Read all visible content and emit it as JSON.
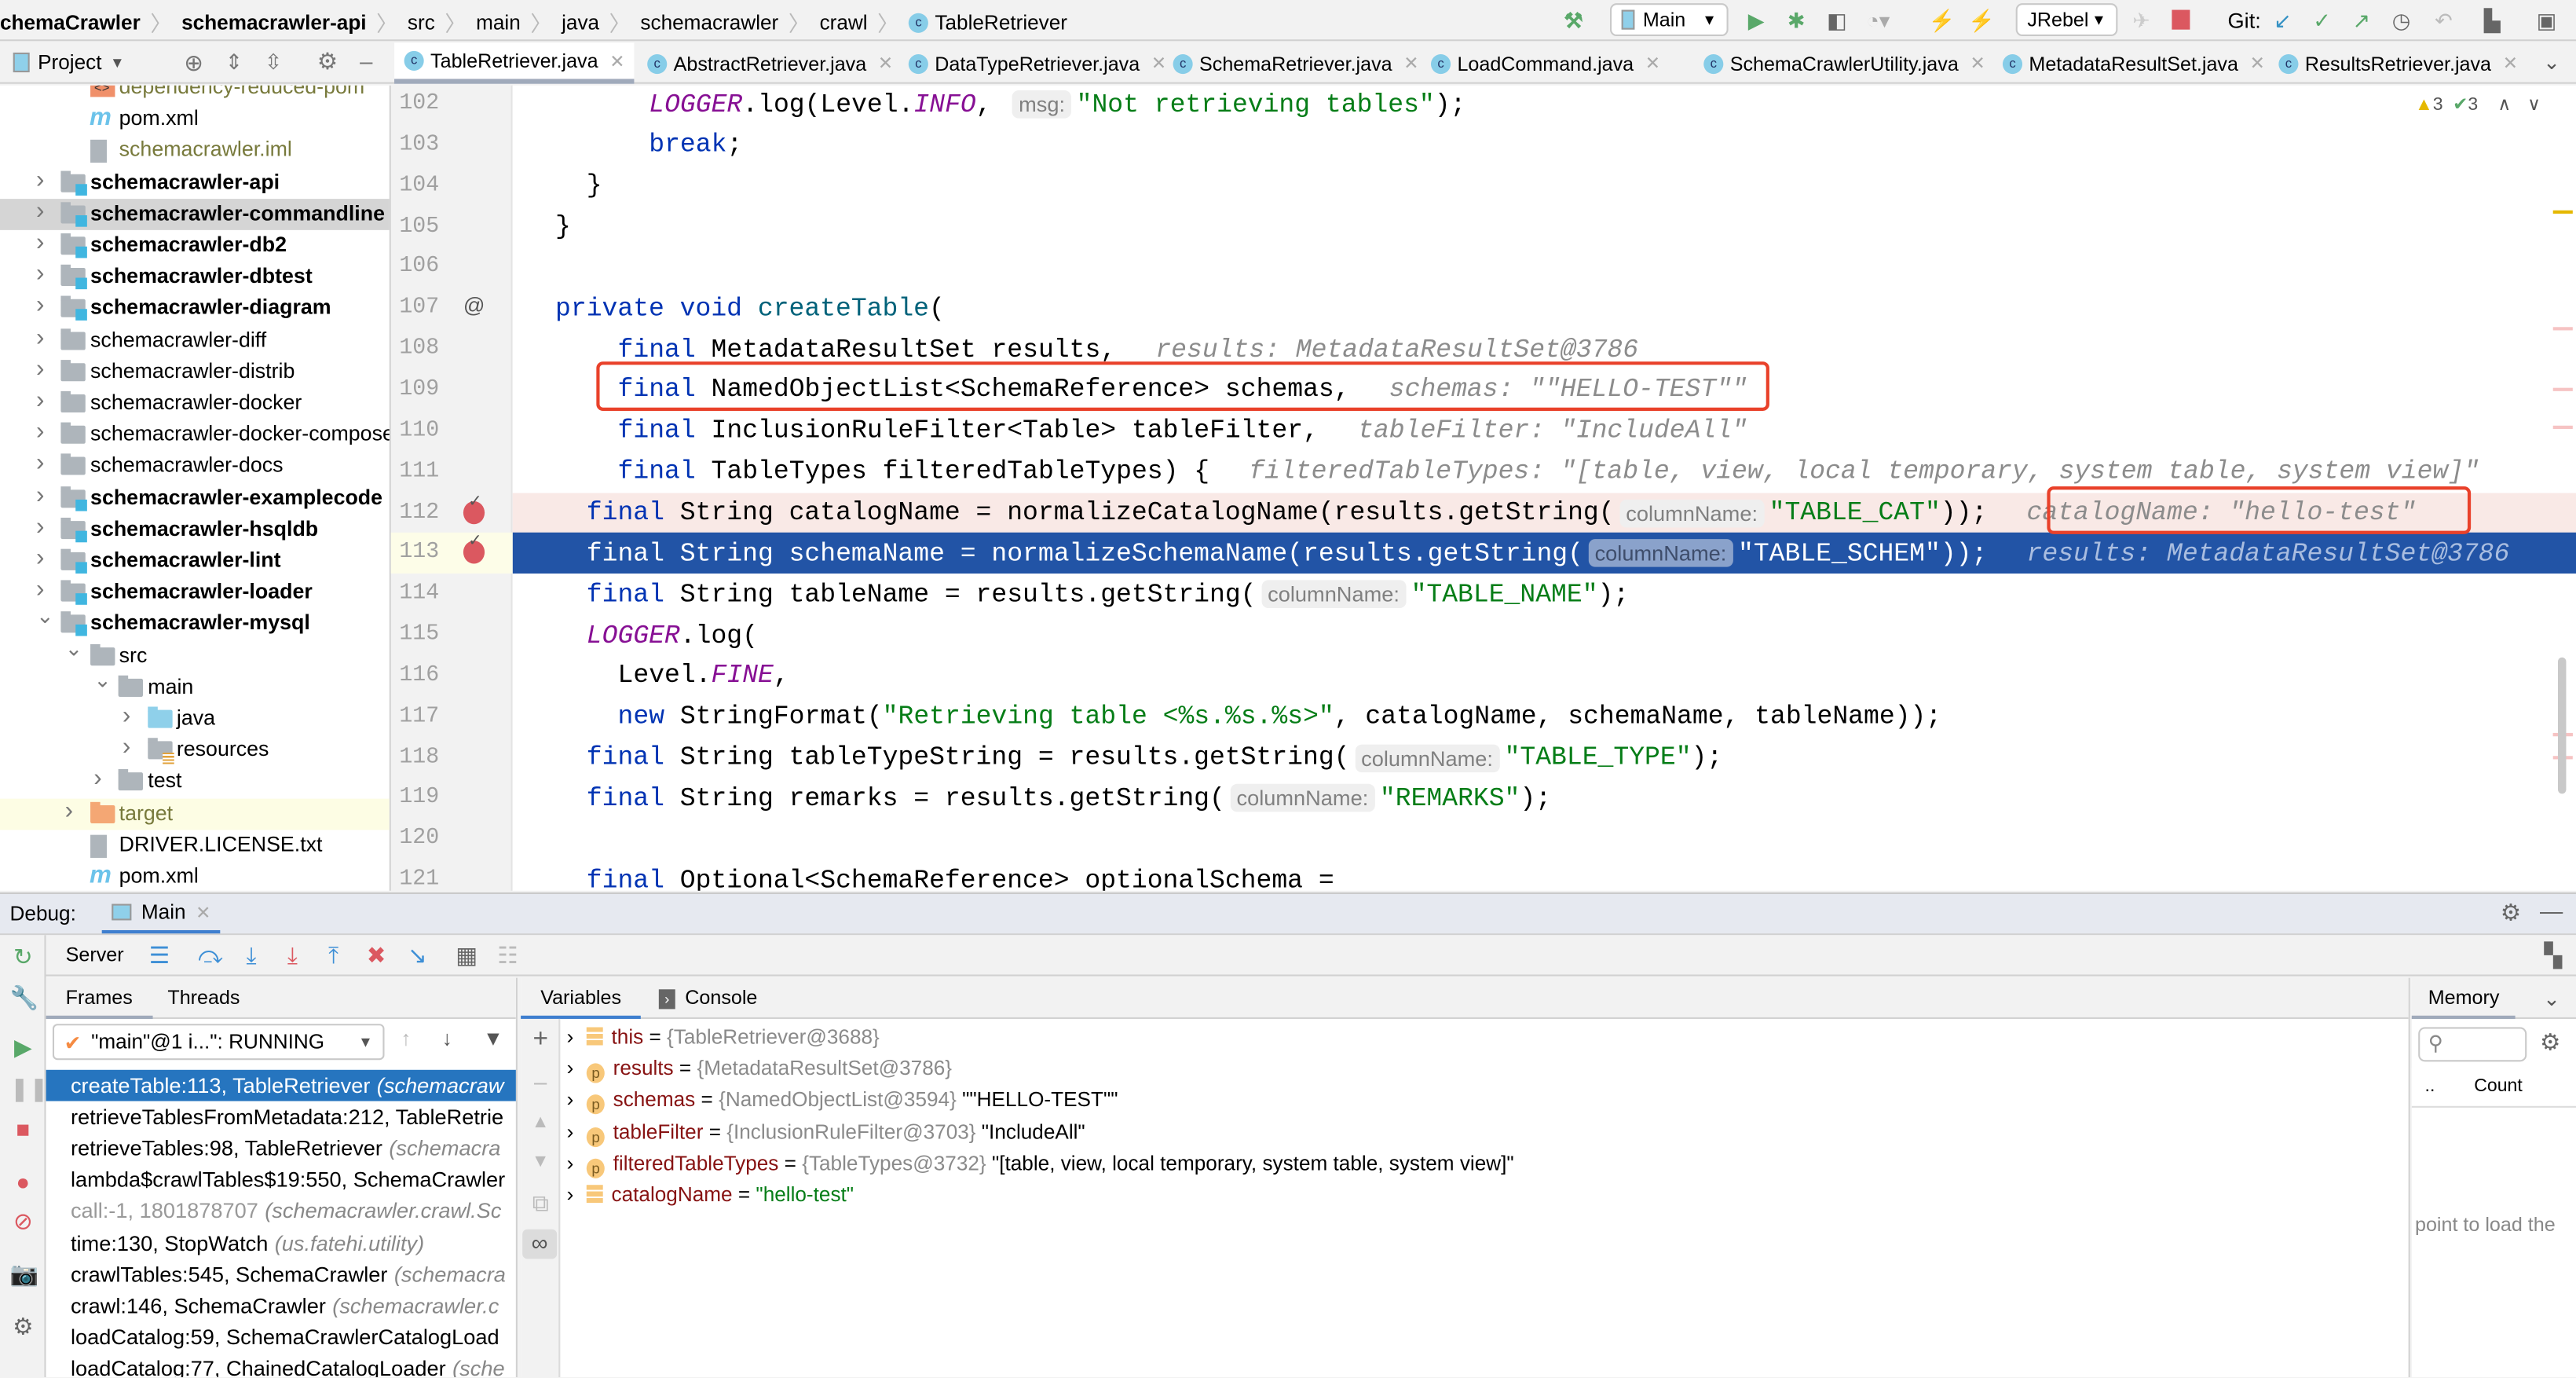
{
  "colors": {
    "accent": "#2675bf",
    "current_line": "#2254a6",
    "breakpoint_line": "#f9e9e6",
    "breakpoint": "#db5860",
    "highlight_box": "#e9412a"
  },
  "breadcrumb": [
    {
      "label": "chemaCrawler",
      "bold": true
    },
    {
      "label": "schemacrawler-api",
      "bold": true
    },
    {
      "label": "src"
    },
    {
      "label": "main"
    },
    {
      "label": "java"
    },
    {
      "label": "schemacrawler"
    },
    {
      "label": "crawl"
    },
    {
      "label": "TableRetriever",
      "icon": "class-icon"
    }
  ],
  "toolbar": {
    "run_config": "Main",
    "jrebel_config": "JRebel",
    "git_label": "Git:"
  },
  "project_panel": {
    "title": "Project"
  },
  "editor_tabs": [
    "TableRetriever.java",
    "AbstractRetriever.java",
    "DataTypeRetriever.java",
    "SchemaRetriever.java",
    "LoadCommand.java",
    "SchemaCrawlerUtility.java",
    "MetadataResultSet.java",
    "ResultsRetriever.java"
  ],
  "inspections": {
    "warnings": "3",
    "weak_warnings": "3"
  },
  "tree": [
    {
      "label": "dependency-reduced-pom",
      "depth": 1,
      "icon": "xml",
      "color": "olive"
    },
    {
      "label": "pom.xml",
      "depth": 1,
      "icon": "maven"
    },
    {
      "label": "schemacrawler.iml",
      "depth": 1,
      "icon": "iml",
      "color": "olive"
    },
    {
      "label": "schemacrawler-api",
      "depth": 0,
      "icon": "module",
      "bold": true,
      "chevron": "closed"
    },
    {
      "label": "schemacrawler-commandline",
      "depth": 0,
      "icon": "module",
      "bold": true,
      "chevron": "closed",
      "selected": true
    },
    {
      "label": "schemacrawler-db2",
      "depth": 0,
      "icon": "module",
      "bold": true,
      "chevron": "closed"
    },
    {
      "label": "schemacrawler-dbtest",
      "depth": 0,
      "icon": "module",
      "bold": true,
      "chevron": "closed"
    },
    {
      "label": "schemacrawler-diagram",
      "depth": 0,
      "icon": "module",
      "bold": true,
      "chevron": "closed"
    },
    {
      "label": "schemacrawler-diff",
      "depth": 0,
      "icon": "folder",
      "chevron": "closed"
    },
    {
      "label": "schemacrawler-distrib",
      "depth": 0,
      "icon": "folder",
      "chevron": "closed"
    },
    {
      "label": "schemacrawler-docker",
      "depth": 0,
      "icon": "folder",
      "chevron": "closed"
    },
    {
      "label": "schemacrawler-docker-compose",
      "depth": 0,
      "icon": "folder",
      "chevron": "closed"
    },
    {
      "label": "schemacrawler-docs",
      "depth": 0,
      "icon": "folder",
      "chevron": "closed"
    },
    {
      "label": "schemacrawler-examplecode",
      "depth": 0,
      "icon": "module",
      "bold": true,
      "chevron": "closed"
    },
    {
      "label": "schemacrawler-hsqldb",
      "depth": 0,
      "icon": "module",
      "bold": true,
      "chevron": "closed"
    },
    {
      "label": "schemacrawler-lint",
      "depth": 0,
      "icon": "module",
      "bold": true,
      "chevron": "closed"
    },
    {
      "label": "schemacrawler-loader",
      "depth": 0,
      "icon": "module",
      "bold": true,
      "chevron": "closed"
    },
    {
      "label": "schemacrawler-mysql",
      "depth": 0,
      "icon": "module",
      "bold": true,
      "chevron": "open"
    },
    {
      "label": "src",
      "depth": 1,
      "icon": "folder",
      "chevron": "open"
    },
    {
      "label": "main",
      "depth": 2,
      "icon": "folder",
      "chevron": "open"
    },
    {
      "label": "java",
      "depth": 3,
      "icon": "source",
      "chevron": "closed"
    },
    {
      "label": "resources",
      "depth": 3,
      "icon": "resources",
      "chevron": "closed"
    },
    {
      "label": "test",
      "depth": 2,
      "icon": "folder",
      "chevron": "closed"
    },
    {
      "label": "target",
      "depth": 1,
      "icon": "excluded",
      "chevron": "closed",
      "color": "olive",
      "highlight": true
    },
    {
      "label": "DRIVER.LICENSE.txt",
      "depth": 1,
      "icon": "text"
    },
    {
      "label": "pom.xml",
      "depth": 1,
      "icon": "maven"
    }
  ],
  "code": {
    "first_line": 102,
    "current_line": 113,
    "breakpoint_lines": [
      112,
      113
    ],
    "lines": [
      {
        "indent": 6,
        "tokens": [
          [
            "cst",
            "LOGGER"
          ],
          [
            "",
            ".log(Level."
          ],
          [
            "cst",
            "INFO"
          ],
          [
            "",
            ", "
          ],
          [
            "hint",
            "msg:"
          ],
          [
            "str",
            "\"Not retrieving tables\""
          ],
          [
            "",
            ");"
          ]
        ]
      },
      {
        "indent": 6,
        "tokens": [
          [
            "kw",
            "break"
          ],
          [
            "",
            ";"
          ]
        ]
      },
      {
        "indent": 2,
        "tokens": [
          [
            "",
            "}"
          ]
        ]
      },
      {
        "indent": 0,
        "tokens": [
          [
            "",
            "}"
          ]
        ]
      },
      {
        "indent": 0,
        "tokens": []
      },
      {
        "indent": 0,
        "tokens": [
          [
            "kw",
            "private void "
          ],
          [
            "fn",
            "createTable"
          ],
          [
            "",
            "("
          ]
        ]
      },
      {
        "indent": 4,
        "tokens": [
          [
            "kw",
            "final "
          ],
          [
            "",
            "MetadataResultSet results,"
          ],
          [
            "val",
            "results: MetadataResultSet@3786"
          ]
        ]
      },
      {
        "indent": 4,
        "tokens": [
          [
            "kw",
            "final "
          ],
          [
            "",
            "NamedObjectList<SchemaReference> schemas,"
          ],
          [
            "val",
            "schemas: \"\"HELLO-TEST\"\""
          ]
        ],
        "boxed": true
      },
      {
        "indent": 4,
        "tokens": [
          [
            "kw",
            "final "
          ],
          [
            "",
            "InclusionRuleFilter<Table> tableFilter,"
          ],
          [
            "val",
            "tableFilter: \"IncludeAll\""
          ]
        ]
      },
      {
        "indent": 4,
        "tokens": [
          [
            "kw",
            "final "
          ],
          [
            "",
            "TableTypes filteredTableTypes) {"
          ],
          [
            "val",
            "filteredTableTypes: \"[table, view, local temporary, system table, system view]\""
          ]
        ]
      },
      {
        "indent": 2,
        "tokens": [
          [
            "kw",
            "final "
          ],
          [
            "",
            "String catalogName = normalizeCatalogName(results.getString("
          ],
          [
            "hint",
            "columnName:"
          ],
          [
            "str",
            "\"TABLE_CAT\""
          ],
          [
            "",
            "));"
          ],
          [
            "val",
            "catalogName: \"hello-test\""
          ]
        ],
        "boxed_value": true
      },
      {
        "indent": 2,
        "tokens": [
          [
            "kw",
            "final "
          ],
          [
            "",
            "String schemaName = normalizeSchemaName(results.getString("
          ],
          [
            "hint",
            "columnName:"
          ],
          [
            "str",
            "\"TABLE_SCHEM\""
          ],
          [
            "",
            "));"
          ],
          [
            "val",
            "results: MetadataResultSet@3786"
          ]
        ]
      },
      {
        "indent": 2,
        "tokens": [
          [
            "kw",
            "final "
          ],
          [
            "",
            "String tableName = results.getString("
          ],
          [
            "hint",
            "columnName:"
          ],
          [
            "str",
            "\"TABLE_NAME\""
          ],
          [
            "",
            ");"
          ]
        ]
      },
      {
        "indent": 2,
        "tokens": [
          [
            "cst",
            "LOGGER"
          ],
          [
            "",
            ".log("
          ]
        ]
      },
      {
        "indent": 4,
        "tokens": [
          [
            "",
            "Level."
          ],
          [
            "cst",
            "FINE"
          ],
          [
            "",
            ","
          ]
        ]
      },
      {
        "indent": 4,
        "tokens": [
          [
            "kw",
            "new "
          ],
          [
            "",
            "StringFormat("
          ],
          [
            "str",
            "\"Retrieving table <%s.%s.%s>\""
          ],
          [
            "",
            ", catalogName, schemaName, tableName));"
          ]
        ]
      },
      {
        "indent": 2,
        "tokens": [
          [
            "kw",
            "final "
          ],
          [
            "",
            "String tableTypeString = results.getString("
          ],
          [
            "hint",
            "columnName:"
          ],
          [
            "str",
            "\"TABLE_TYPE\""
          ],
          [
            "",
            ");"
          ]
        ]
      },
      {
        "indent": 2,
        "tokens": [
          [
            "kw",
            "final "
          ],
          [
            "",
            "String remarks = results.getString("
          ],
          [
            "hint",
            "columnName:"
          ],
          [
            "str",
            "\"REMARKS\""
          ],
          [
            "",
            ");"
          ]
        ]
      },
      {
        "indent": 0,
        "tokens": []
      },
      {
        "indent": 2,
        "tokens": [
          [
            "kw",
            "final "
          ],
          [
            "",
            "Optional<SchemaReference> optionalSchema ="
          ]
        ]
      }
    ]
  },
  "debug": {
    "title": "Debug:",
    "session_tab": "Main",
    "server_label": "Server",
    "frames_tab": "Frames",
    "threads_tab": "Threads",
    "thread_select": "\"main\"@1 i...\": RUNNING",
    "frames": [
      {
        "method": "createTable:113, TableRetriever",
        "pkg": "(schemacraw",
        "selected": true
      },
      {
        "method": "retrieveTablesFromMetadata:212, TableRetrie",
        "pkg": ""
      },
      {
        "method": "retrieveTables:98, TableRetriever",
        "pkg": "(schemacra"
      },
      {
        "method": "lambda$crawlTables$19:550, SchemaCrawler",
        "pkg": ""
      },
      {
        "method": "call:-1, 1801878707",
        "pkg": "(schemacrawler.crawl.Sc",
        "dim": true
      },
      {
        "method": "time:130, StopWatch",
        "pkg": "(us.fatehi.utility)"
      },
      {
        "method": "crawlTables:545, SchemaCrawler",
        "pkg": "(schemacra"
      },
      {
        "method": "crawl:146, SchemaCrawler",
        "pkg": "(schemacrawler.c"
      },
      {
        "method": "loadCatalog:59, SchemaCrawlerCatalogLoad",
        "pkg": ""
      },
      {
        "method": "loadCatalog:77, ChainedCatalogLoader",
        "pkg": "(sche"
      }
    ],
    "variables_tab": "Variables",
    "console_tab": "Console",
    "variables": [
      {
        "name": "this",
        "type": "{TableRetriever@3688}",
        "value": "",
        "kind": "field"
      },
      {
        "name": "results",
        "type": "{MetadataResultSet@3786}",
        "value": "",
        "kind": "param"
      },
      {
        "name": "schemas",
        "type": "{NamedObjectList@3594}",
        "value": "\"\"HELLO-TEST\"\"",
        "kind": "param"
      },
      {
        "name": "tableFilter",
        "type": "{InclusionRuleFilter@3703}",
        "value": "\"IncludeAll\"",
        "kind": "param"
      },
      {
        "name": "filteredTableTypes",
        "type": "{TableTypes@3732}",
        "value": "\"[table, view, local temporary, system table, system view]\"",
        "kind": "param"
      },
      {
        "name": "catalogName",
        "type": "",
        "value": "\"hello-test\"",
        "kind": "field",
        "string": true
      }
    ],
    "memory": {
      "tab": "Memory",
      "col_dots": "..",
      "col_count": "Count",
      "hint": "point to load the",
      "search_placeholder": ""
    }
  }
}
